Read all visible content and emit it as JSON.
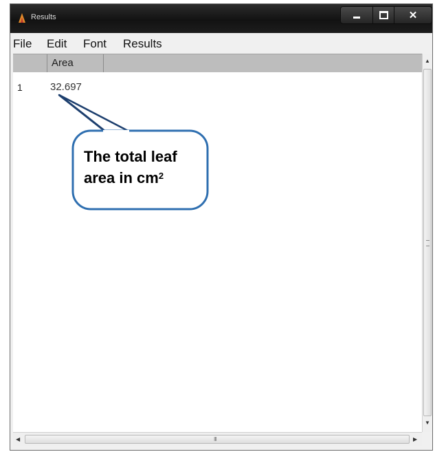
{
  "window": {
    "title": "Results"
  },
  "menu": [
    "File",
    "Edit",
    "Font",
    "Results"
  ],
  "table": {
    "columns": [
      "",
      "Area"
    ],
    "rows": [
      {
        "index": "1",
        "area": "32.697"
      }
    ]
  },
  "scrollbars": {
    "horizontal_grip": "III"
  },
  "callout": {
    "line1": "The total leaf",
    "line2": "area in cm",
    "superscript": "2"
  },
  "colors": {
    "titlebar": "#1a1a1a",
    "header": "#bdbdbd",
    "callout_border": "#2f6fb0",
    "callout_pointer": "#1d3f6e"
  },
  "icons": [
    "app-icon",
    "minimize-icon",
    "maximize-icon",
    "close-icon",
    "scroll-up-icon",
    "scroll-down-icon",
    "scroll-left-icon",
    "scroll-right-icon"
  ]
}
